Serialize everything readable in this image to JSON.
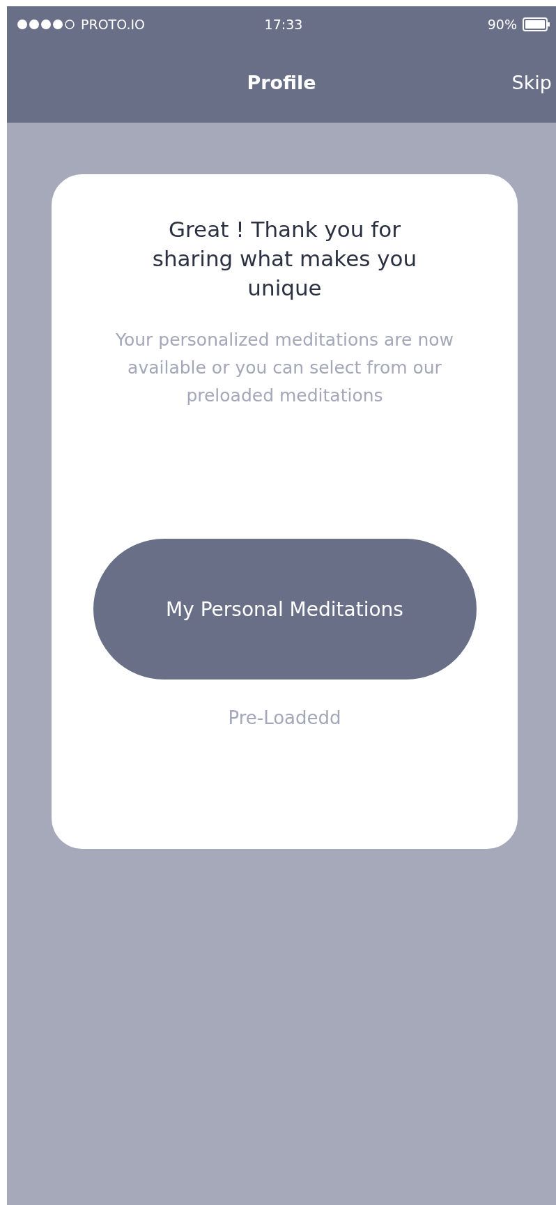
{
  "status_bar": {
    "carrier": "PROTO.IO",
    "time": "17:33",
    "battery": "90%"
  },
  "nav_bar": {
    "title": "Profile",
    "action": "Skip"
  },
  "card": {
    "title": "Great ! Thank you for sharing what makes you unique",
    "message": "Your personalized meditations are now available or you can select from our preloaded meditations",
    "primary_button": "My Personal Meditations",
    "secondary_link": "Pre-Loadedd"
  }
}
